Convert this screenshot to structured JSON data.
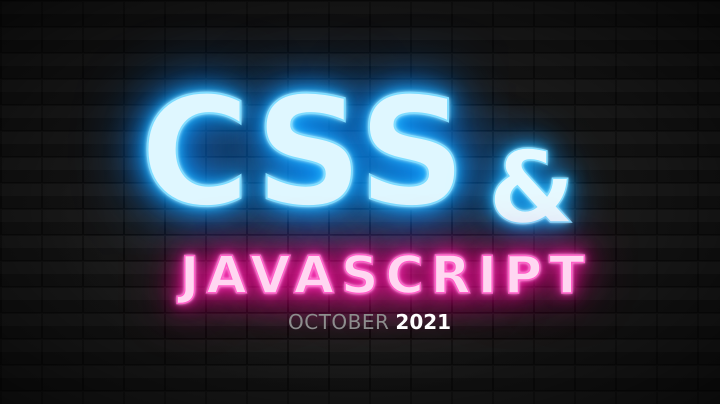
{
  "graphic": {
    "main_word": "CSS",
    "connector": "&",
    "sub_word": "JAVASCRIPT",
    "date_month": "OCTOBER",
    "date_year": "2021"
  },
  "colors": {
    "background": "#151515",
    "neon_blue": "#14a8ff",
    "neon_pink": "#ff1aa8",
    "date_month": "#8d8d8d",
    "date_year": "#ffffff"
  }
}
